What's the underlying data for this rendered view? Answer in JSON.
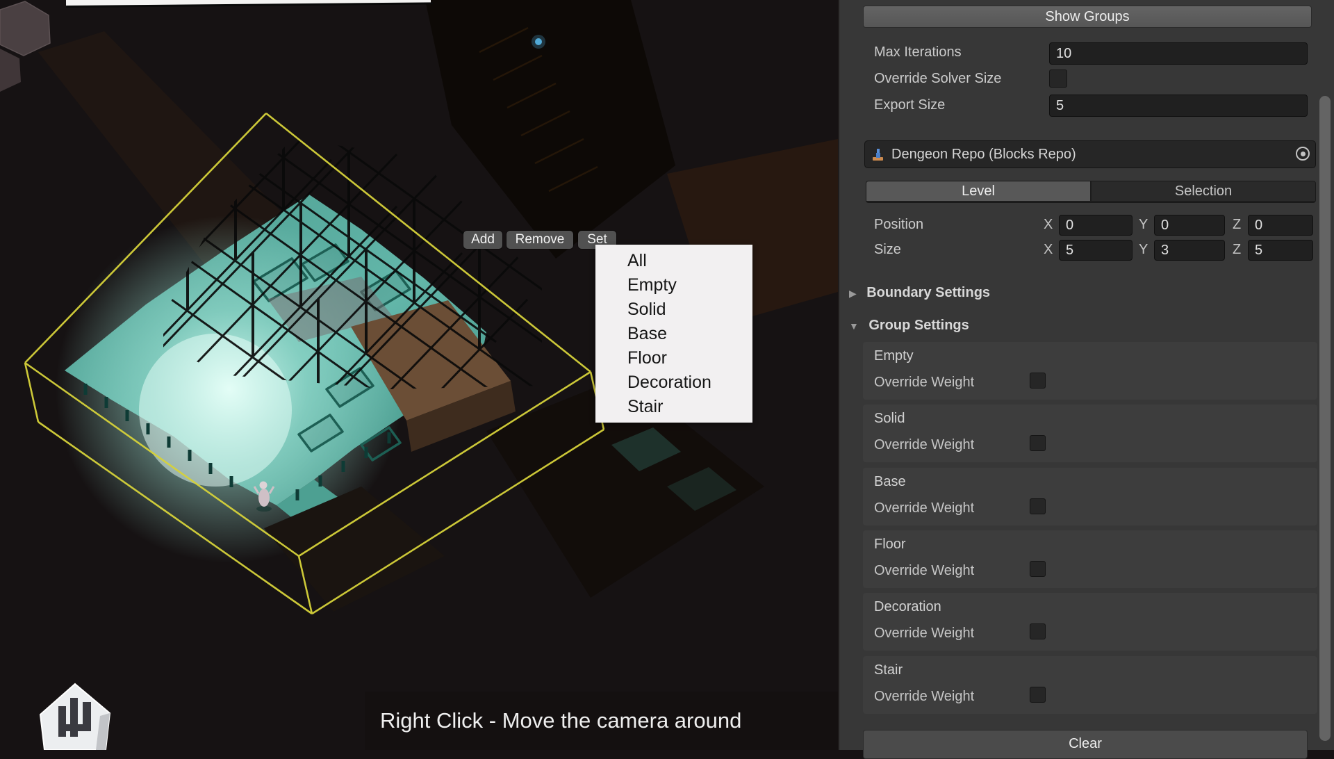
{
  "colors": {
    "wireframe_accent": "#d6d23a",
    "floor_teal": "#5fb3a6",
    "panel_bg": "#373737",
    "menu_bg": "#f2f0f1",
    "selected_tab": "#585858",
    "overlay_bg": "#141111"
  },
  "scene": {
    "toolbar": {
      "add": "Add",
      "remove": "Remove",
      "set": "Set"
    },
    "context_menu": [
      "All",
      "Empty",
      "Solid",
      "Base",
      "Floor",
      "Decoration",
      "Stair"
    ],
    "hint": "Right Click - Move the camera around"
  },
  "inspector": {
    "show_groups": "Show Groups",
    "max_iterations": {
      "label": "Max Iterations",
      "value": "10"
    },
    "override_solver_size": {
      "label": "Override Solver Size"
    },
    "export_size": {
      "label": "Export Size",
      "value": "5"
    },
    "repo": {
      "label": "Dengeon Repo (Blocks Repo)"
    },
    "tabs": {
      "level": "Level",
      "selection": "Selection",
      "active": "Level"
    },
    "axis": {
      "x": "X",
      "y": "Y",
      "z": "Z"
    },
    "position": {
      "label": "Position",
      "x": "0",
      "y": "0",
      "z": "0"
    },
    "size": {
      "label": "Size",
      "x": "5",
      "y": "3",
      "z": "5"
    },
    "boundary_settings": "Boundary Settings",
    "group_settings": "Group Settings",
    "override_weight": "Override Weight",
    "groups": [
      "Empty",
      "Solid",
      "Base",
      "Floor",
      "Decoration",
      "Stair"
    ],
    "clear": "Clear"
  }
}
